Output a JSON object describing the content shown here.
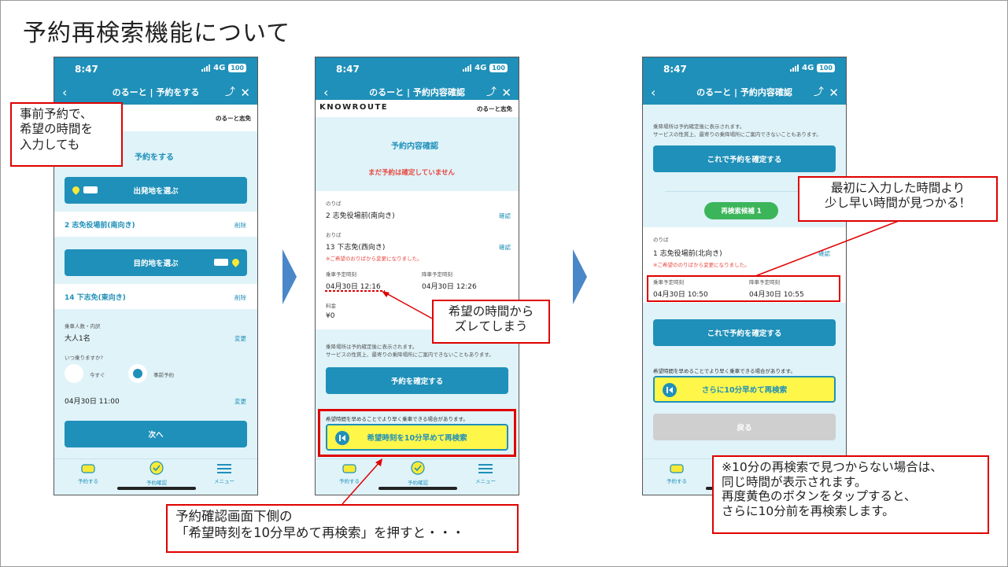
{
  "title": "予約再検索機能について",
  "status": {
    "time": "8:47",
    "network": "4G",
    "battery": "100"
  },
  "colors": {
    "brand": "#1f90b9",
    "alert": "#e8453c",
    "highlight_button": "#fff64a",
    "callout_border": "#e00000"
  },
  "phone1": {
    "nav_title": "のるーと | 予約をする",
    "brand_right": "のるーと志免",
    "section_title": "予約をする",
    "origin_button": "出発地を選ぶ",
    "origin_value": "2 志免役場前(南向き)",
    "origin_delete": "削除",
    "dest_button": "目的地を選ぶ",
    "dest_value": "14 下志免(東向き)",
    "dest_delete": "削除",
    "passengers_label": "乗車人数・内訳",
    "passengers_value": "大人1名",
    "passengers_change": "変更",
    "when_label": "いつ乗りますか?",
    "option_now": "今すぐ",
    "option_reserve": "事前予約",
    "datetime": "04月30日 11:00",
    "datetime_change": "変更",
    "next_button": "次へ"
  },
  "phone2": {
    "nav_title": "のるーと | 予約内容確認",
    "logo": "KNOWROUTE",
    "brand_right": "のるーと志免",
    "section_title": "予約内容確認",
    "not_confirmed": "まだ予約は確定していません",
    "pickup_label": "のりば",
    "pickup_value": "2 志免役場前(南向き)",
    "pickup_confirm": "確認",
    "dropoff_label": "おりば",
    "dropoff_value": "13 下志免(西向き)",
    "dropoff_confirm": "確認",
    "dropoff_note": "※ご希望のおりばから変更になりました。",
    "board_time_label": "乗車予定時刻",
    "board_time_value": "04月30日 12:16",
    "alight_time_label": "降車予定時刻",
    "alight_time_value": "04月30日 12:26",
    "fare_label": "料金",
    "fare_value": "¥0",
    "notice_1": "乗降場所は予約確定後に表示されます。",
    "notice_2": "サービスの性質上、最寄りの乗降場所にご案内できないこともあります。",
    "confirm_button": "予約を確定する",
    "early_note": "希望時間を早めることでより早く乗車できる場合があります。",
    "research_button": "希望時刻を10分早めて再検索"
  },
  "phone3": {
    "nav_title": "のるーと | 予約内容確認",
    "notice_1": "乗降場所は予約確定後に表示されます。",
    "notice_2": "サービスの性質上、最寄りの乗降場所にご案内できないこともあります。",
    "confirm_button_top": "これで予約を確定する",
    "candidate_badge": "再検索候補 1",
    "pickup_label": "のりば",
    "pickup_value": "1 志免役場前(北向き)",
    "pickup_confirm": "確認",
    "pickup_note": "※ご希望ののりばから変更になりました。",
    "board_time_label": "乗車予定時刻",
    "board_time_value": "04月30日 10:50",
    "alight_time_label": "降車予定時刻",
    "alight_time_value": "04月30日 10:55",
    "confirm_button": "これで予約を確定する",
    "early_note": "希望時間を早めることでより早く乗車できる場合があります。",
    "research_button": "さらに10分早めて再検索",
    "back_button": "戻る"
  },
  "tabs": [
    "予約する",
    "予約確認",
    "メニュー"
  ],
  "callouts": {
    "c1": [
      "事前予約で、",
      "希望の時間を",
      "入力しても"
    ],
    "c2": [
      "希望の時間から",
      "ズレてしまう"
    ],
    "c3": [
      "予約確認画面下側の",
      "「希望時刻を10分早めて再検索」を押すと・・・"
    ],
    "c4": [
      "最初に入力した時間より",
      "少し早い時間が見つかる！"
    ],
    "c5": [
      "※10分の再検索で見つからない場合は、",
      "同じ時間が表示されます。",
      "再度黄色のボタンをタップすると、",
      "さらに10分前を再検索します。"
    ]
  }
}
